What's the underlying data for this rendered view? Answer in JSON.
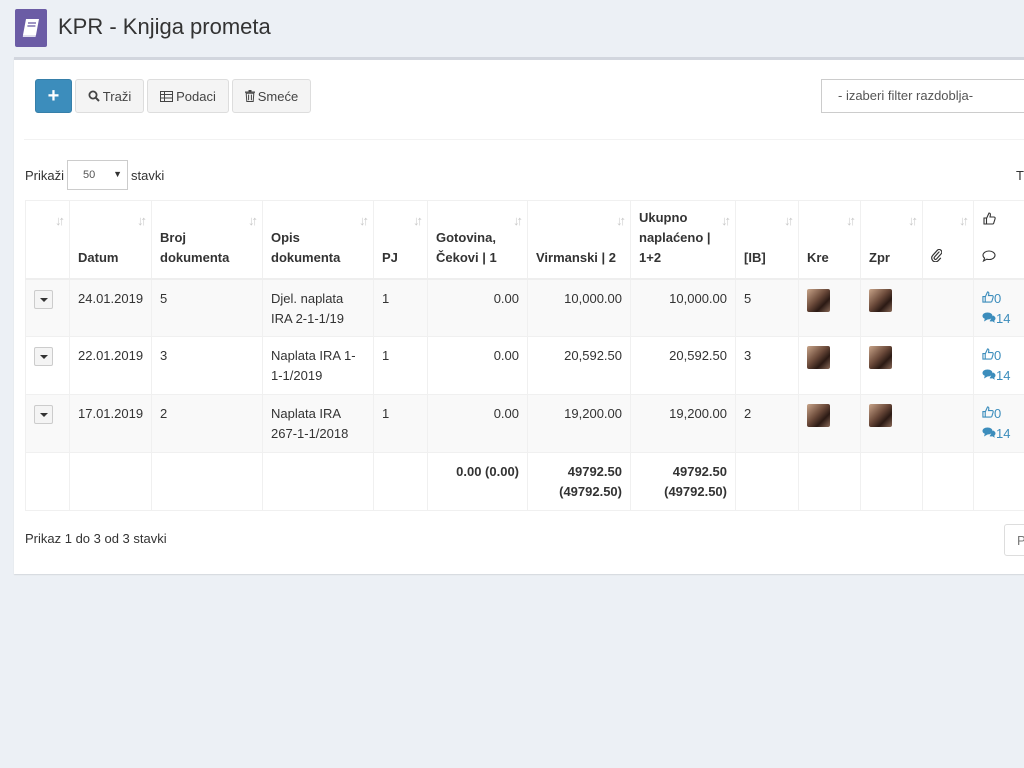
{
  "header": {
    "title": "KPR - Knjiga prometa"
  },
  "toolbar": {
    "add_label": "+",
    "search_label": "Traži",
    "data_label": "Podaci",
    "trash_label": "Smeće",
    "filter_placeholder": "- izaberi filter razdoblja-"
  },
  "length": {
    "show_label": "Prikaži",
    "value": "50",
    "items_label": "stavki"
  },
  "search_cut_label": "T",
  "table": {
    "columns": {
      "datum": "Datum",
      "broj": "Broj dokumenta",
      "opis": "Opis dokumenta",
      "pj": "PJ",
      "gotovina": "Gotovina, Čekovi | 1",
      "virmanski": "Virmanski | 2",
      "ukupno": "Ukupno naplaćeno | 1+2",
      "ib": "[IB]",
      "kre": "Kre",
      "zpr": "Zpr"
    },
    "rows": [
      {
        "datum": "24.01.2019",
        "broj": "5",
        "opis": "Djel. naplata IRA 2-1-1/19",
        "pj": "1",
        "gotovina": "0.00",
        "virmanski": "10,000.00",
        "ukupno": "10,000.00",
        "ib": "5",
        "likes": "0",
        "comments": "14"
      },
      {
        "datum": "22.01.2019",
        "broj": "3",
        "opis": "Naplata IRA 1-1-1/2019",
        "pj": "1",
        "gotovina": "0.00",
        "virmanski": "20,592.50",
        "ukupno": "20,592.50",
        "ib": "3",
        "likes": "0",
        "comments": "14"
      },
      {
        "datum": "17.01.2019",
        "broj": "2",
        "opis": "Naplata IRA 267-1-1/2018",
        "pj": "1",
        "gotovina": "0.00",
        "virmanski": "19,200.00",
        "ukupno": "19,200.00",
        "ib": "2",
        "likes": "0",
        "comments": "14"
      }
    ],
    "totals": {
      "gotovina": "0.00 (0.00)",
      "virmanski": "49792.50 (49792.50)",
      "ukupno": "49792.50 (49792.50)"
    }
  },
  "footer": {
    "info": "Prikaz 1 do 3 od 3 stavki",
    "pager_label": "P"
  },
  "colors": {
    "accent": "#3c8dbc",
    "app_icon": "#6b5ca5",
    "background": "#ecf0f5"
  }
}
